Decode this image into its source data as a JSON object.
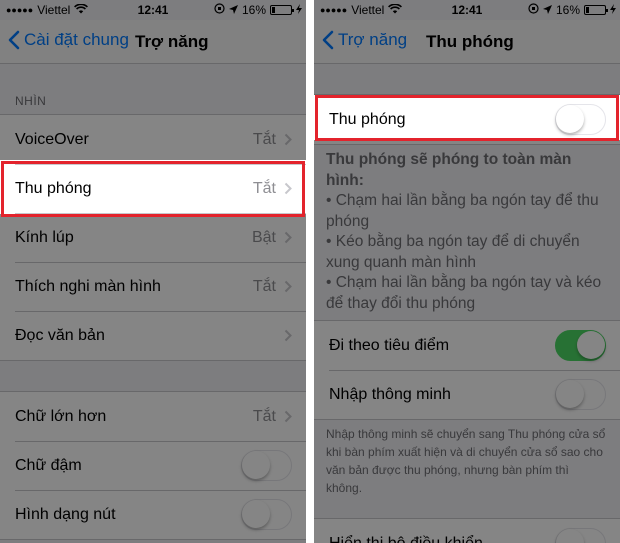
{
  "left_screen": {
    "status": {
      "carrier": "Viettel",
      "time": "12:41",
      "battery": "16%"
    },
    "nav": {
      "back_label": "Cài đặt chung",
      "title": "Trợ năng"
    },
    "vision_header": "NHÌN",
    "vision_items": [
      {
        "label": "VoiceOver",
        "value": "Tắt"
      },
      {
        "label": "Thu phóng",
        "value": "Tắt"
      },
      {
        "label": "Kính lúp",
        "value": "Bật"
      },
      {
        "label": "Thích nghi màn hình",
        "value": "Tắt"
      },
      {
        "label": "Đọc văn bản",
        "value": ""
      }
    ],
    "text_items": [
      {
        "label": "Chữ lớn hơn",
        "value": "Tắt"
      },
      {
        "label": "Chữ đậm",
        "toggle": false
      },
      {
        "label": "Hình dạng nút",
        "toggle": false
      }
    ]
  },
  "right_screen": {
    "status": {
      "carrier": "Viettel",
      "time": "12:41",
      "battery": "16%"
    },
    "nav": {
      "back_label": "Trợ năng",
      "title": "Thu phóng"
    },
    "zoom_toggle": {
      "label": "Thu phóng",
      "toggle": false
    },
    "zoom_description": {
      "title": "Thu phóng sẽ phóng to toàn màn hình:",
      "bullets": [
        "• Chạm hai lần bằng ba ngón tay để thu phóng",
        "• Kéo bằng ba ngón tay để di chuyển xung quanh màn hình",
        "• Chạm hai lần bằng ba ngón tay và kéo để thay đổi thu phóng"
      ]
    },
    "follow_focus": {
      "label": "Đi theo tiêu điểm",
      "toggle": true
    },
    "smart_typing": {
      "label": "Nhập thông minh",
      "toggle": false
    },
    "smart_typing_footer": "Nhập thông minh sẽ chuyển sang Thu phóng cửa sổ khi bàn phím xuất hiện và di chuyển cửa sổ sao cho văn bản được thu phóng, nhưng bàn phím thì không.",
    "show_controller": {
      "label": "Hiển thị bộ điều khiển",
      "toggle": false
    }
  },
  "colors": {
    "accent": "#007aff",
    "switch_on": "#4cd964",
    "highlight": "#e3232c"
  }
}
